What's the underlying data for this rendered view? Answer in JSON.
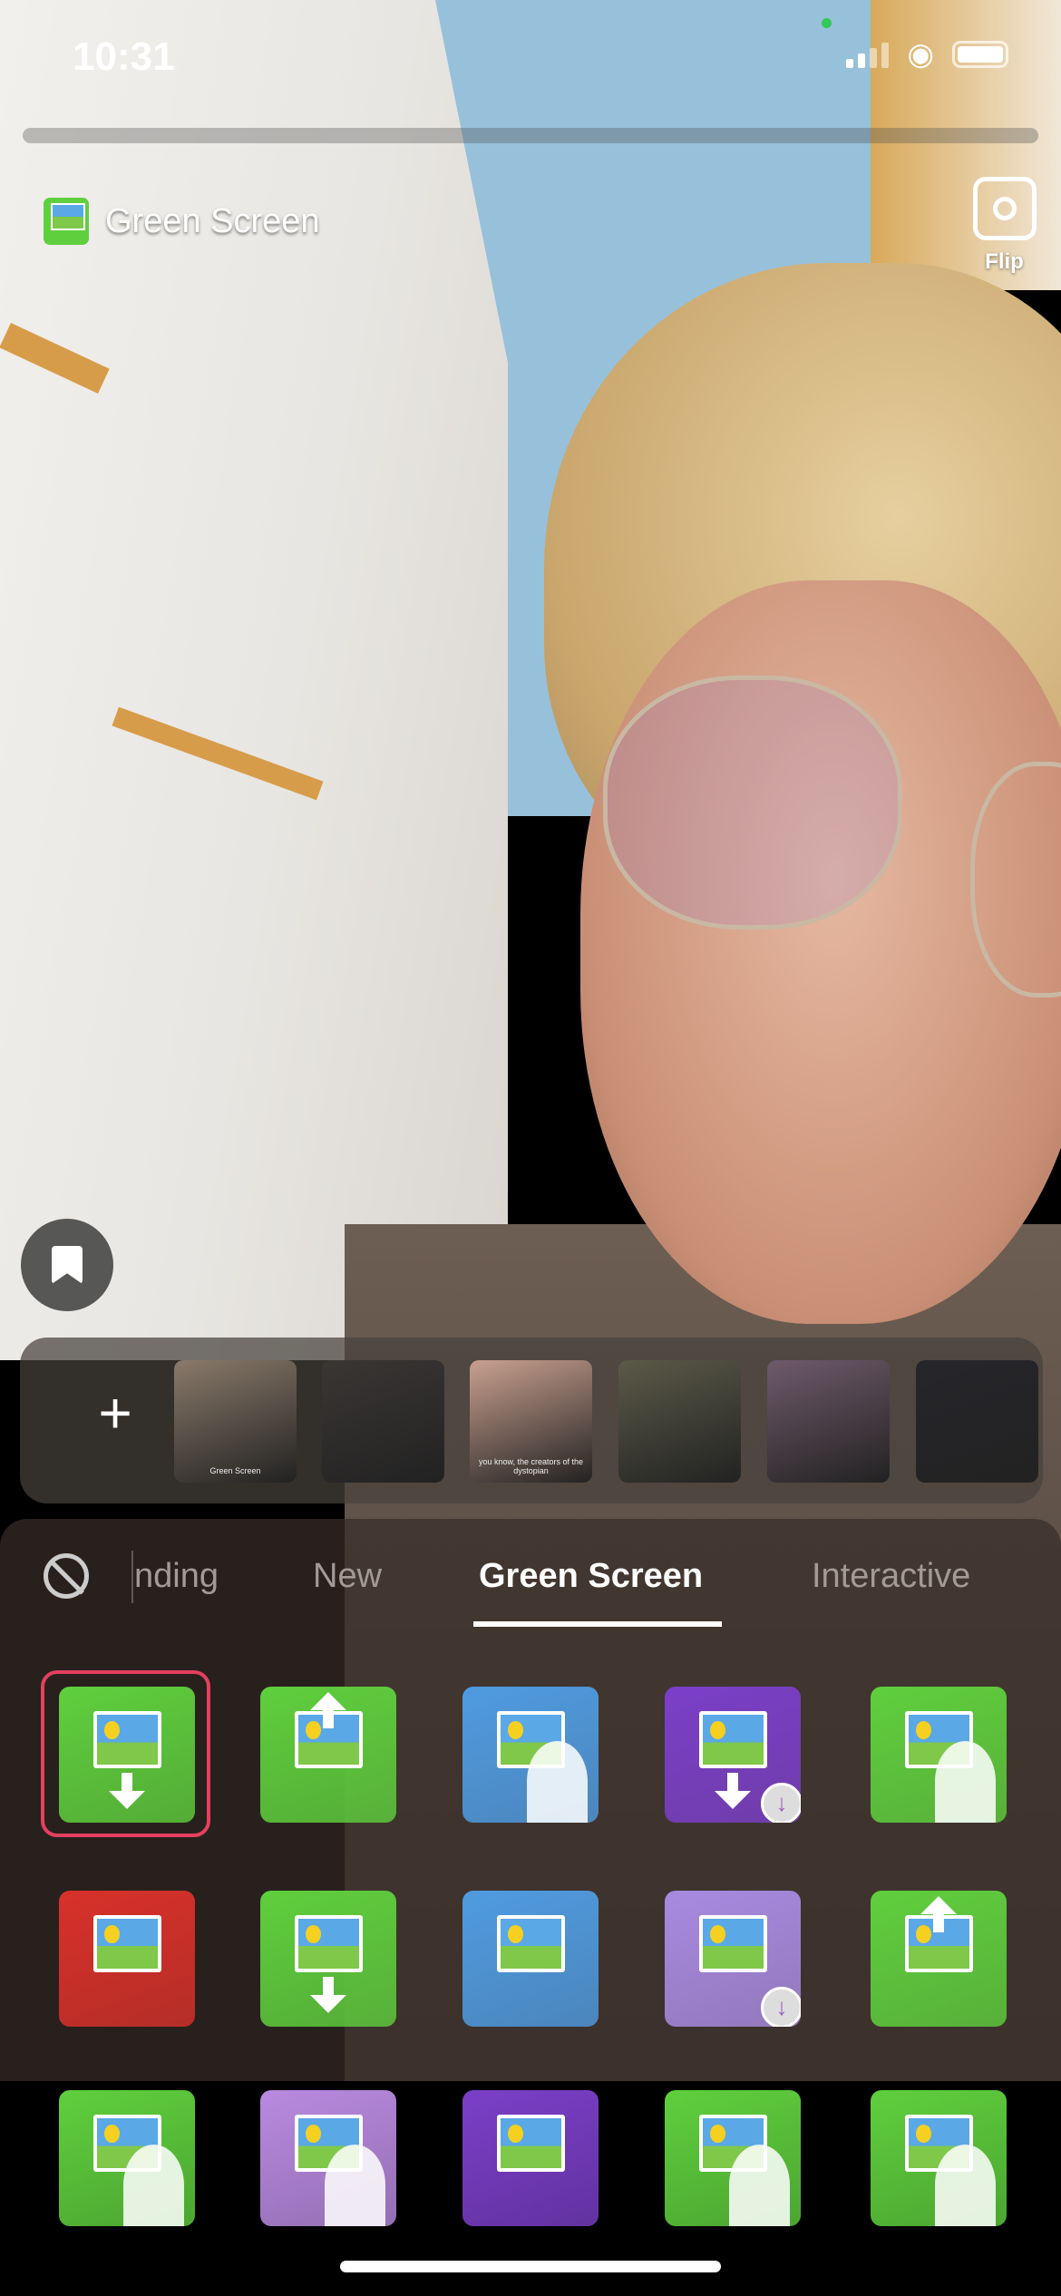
{
  "status_bar": {
    "time": "10:31",
    "location_icon": "location-arrow-icon",
    "signal_icon": "cellular-signal-icon",
    "wifi_icon": "wifi-icon",
    "battery_icon": "battery-icon"
  },
  "effect": {
    "name": "Green Screen",
    "icon": "green-screen-icon"
  },
  "flip": {
    "label": "Flip",
    "icon": "flip-camera-icon"
  },
  "bookmark": {
    "icon": "bookmark-icon"
  },
  "recent_strip": {
    "add_icon": "plus-icon",
    "add_label": "+",
    "thumbnails": [
      {
        "caption": "Green Screen",
        "tone": "#8a7a6a"
      },
      {
        "caption": "",
        "tone": "#3a3634"
      },
      {
        "caption": "you know, the creators of the dystopian",
        "tone": "#c9a08f"
      },
      {
        "caption": "",
        "tone": "#5b5a48"
      },
      {
        "caption": "",
        "tone": "#6f5a6a"
      },
      {
        "caption": "",
        "tone": "#26262b"
      }
    ]
  },
  "tabs": {
    "none_icon": "no-effect-icon",
    "items": [
      {
        "label": "nding",
        "active": false
      },
      {
        "label": "New",
        "active": false
      },
      {
        "label": "Green Screen",
        "active": true
      },
      {
        "label": "Interactive",
        "active": false
      }
    ]
  },
  "effects_grid": [
    {
      "bg": "#5fcf3d",
      "kind": "photo-down",
      "selected": true
    },
    {
      "bg": "#5fcf3d",
      "kind": "video-up",
      "selected": false
    },
    {
      "bg": "#4f9be0",
      "kind": "photo-person",
      "selected": false
    },
    {
      "bg": "#7b3fc8",
      "kind": "heart-download",
      "selected": false,
      "download": true
    },
    {
      "bg": "#5fcf3d",
      "kind": "person-landscape",
      "selected": false
    },
    {
      "bg": "#d8312a",
      "kind": "tilted-photo",
      "selected": false
    },
    {
      "bg": "#5fcf3d",
      "kind": "photo-down",
      "selected": false
    },
    {
      "bg": "#4f9be0",
      "kind": "mask-photo",
      "selected": false
    },
    {
      "bg": "#a88ae0",
      "kind": "heart-shirt",
      "selected": false,
      "download": true
    },
    {
      "bg": "#5fcf3d",
      "kind": "video-up",
      "selected": false
    },
    {
      "bg": "#5fcf3d",
      "kind": "hand-person",
      "selected": false
    },
    {
      "bg": "#b98ae0",
      "kind": "photo-person",
      "selected": false
    },
    {
      "bg": "#7b3fc8",
      "kind": "eyes-photo",
      "selected": false
    },
    {
      "bg": "#5fcf3d",
      "kind": "hand-figure",
      "selected": false
    },
    {
      "bg": "#5fcf3d",
      "kind": "photo-person",
      "selected": false
    }
  ],
  "colors": {
    "accent_selected": "#e4405f",
    "tile_green": "#5fcf3d"
  }
}
